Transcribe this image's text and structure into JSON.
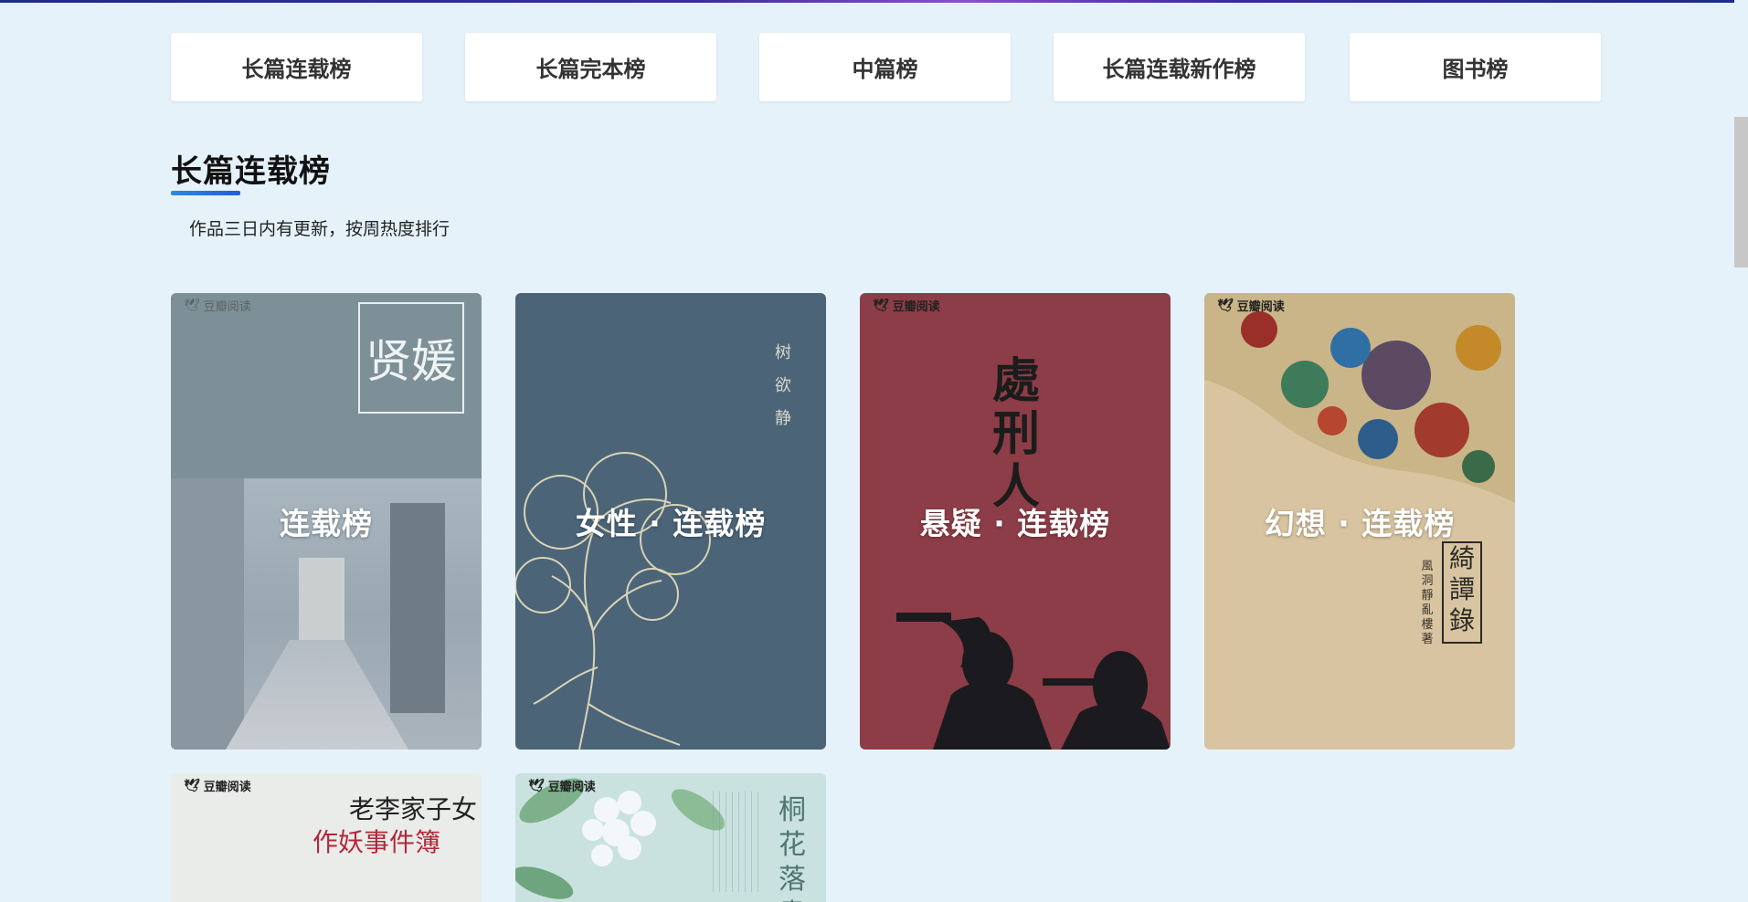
{
  "tabs": [
    {
      "label": "长篇连载榜"
    },
    {
      "label": "长篇完本榜"
    },
    {
      "label": "中篇榜"
    },
    {
      "label": "长篇连载新作榜"
    },
    {
      "label": "图书榜"
    }
  ],
  "section": {
    "title": "长篇连载榜",
    "description": "作品三日内有更新，按周热度排行"
  },
  "cards": [
    {
      "label": "连载榜",
      "cover_text": "贤媛",
      "brand": "豆瓣阅读"
    },
    {
      "label": "女性 · 连载榜",
      "cover_text": "树欲静"
    },
    {
      "label": "悬疑 · 连载榜",
      "cover_text": "處刑人",
      "brand": "豆瓣阅读"
    },
    {
      "label": "幻想 · 连载榜",
      "cover_text": "綺譚錄",
      "cover_author": "風洞靜亂樓著",
      "brand": "豆瓣阅读"
    },
    {
      "cover_text_1": "老李家子女",
      "cover_text_2": "作妖事件簿",
      "brand": "豆瓣阅读"
    },
    {
      "cover_text": "桐花落盡",
      "brand": "豆瓣阅读"
    }
  ],
  "colors": {
    "page_bg": "#e5f2f9",
    "accent": "#1f6fe0",
    "tab_bg": "#ffffff"
  }
}
